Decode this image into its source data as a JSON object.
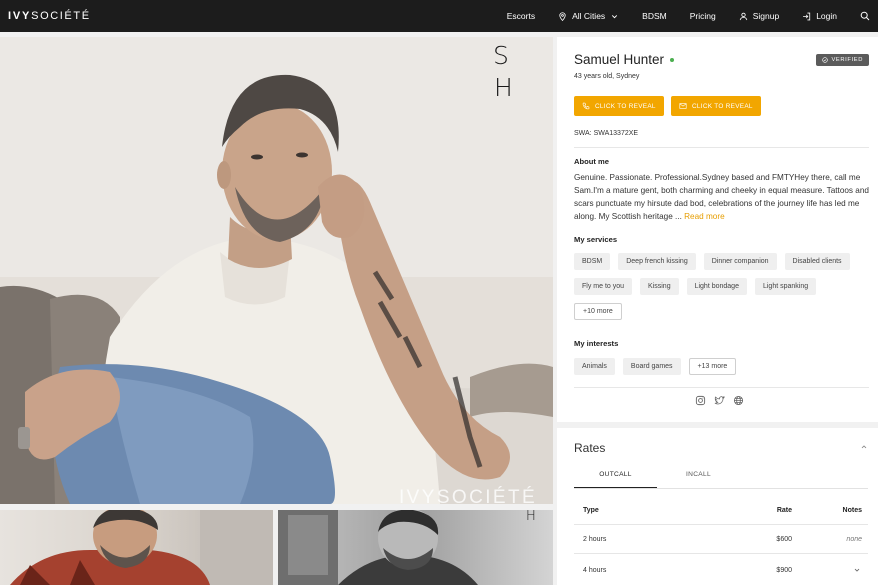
{
  "nav": {
    "logo_bold": "IVY",
    "logo_rest": "SOCIÉTÉ",
    "items": [
      {
        "label": "Escorts",
        "icon": ""
      },
      {
        "label": "All Cities",
        "icon": "location-pin-icon"
      },
      {
        "label": "BDSM",
        "icon": ""
      },
      {
        "label": "Pricing",
        "icon": ""
      },
      {
        "label": "Signup",
        "icon": "user-icon"
      },
      {
        "label": "Login",
        "icon": "login-icon"
      }
    ],
    "search_icon": "search-icon"
  },
  "photos": {
    "monogram_top": "S",
    "monogram_bottom": "H",
    "watermark": "IVYSOCIÉTÉ"
  },
  "profile": {
    "name": "Samuel Hunter",
    "online_color": "#4caf50",
    "verified_label": "VERIFIED",
    "age_location": "43 years old, Sydney",
    "reveal_phone": "CLICK TO REVEAL",
    "reveal_email": "CLICK TO REVEAL",
    "accent_color": "#f2a600",
    "swa": "SWA: SWA13372XE",
    "about_title": "About me",
    "about_text": "Genuine. Passionate. Professional.Sydney based and FMTYHey there, call me Sam.I'm a mature gent, both charming and cheeky in equal measure. Tattoos and scars punctuate my hirsute dad bod, celebrations of the journey life has led me along. My Scottish heritage ...",
    "read_more": "Read more",
    "services_title": "My services",
    "services": [
      "BDSM",
      "Deep french kissing",
      "Dinner companion",
      "Disabled clients",
      "Fly me to you",
      "Kissing",
      "Light bondage",
      "Light spanking"
    ],
    "services_more": "+10 more",
    "interests_title": "My interests",
    "interests": [
      "Animals",
      "Board games"
    ],
    "interests_more": "+13 more",
    "socials": [
      "instagram-icon",
      "twitter-icon",
      "globe-icon"
    ]
  },
  "rates": {
    "title": "Rates",
    "tabs": [
      "OUTCALL",
      "INCALL"
    ],
    "headers": {
      "type": "Type",
      "rate": "Rate",
      "notes": "Notes"
    },
    "rows": [
      {
        "type": "2 hours",
        "rate": "$600",
        "notes": "none"
      },
      {
        "type": "4 hours",
        "rate": "$900",
        "notes": ""
      }
    ]
  }
}
